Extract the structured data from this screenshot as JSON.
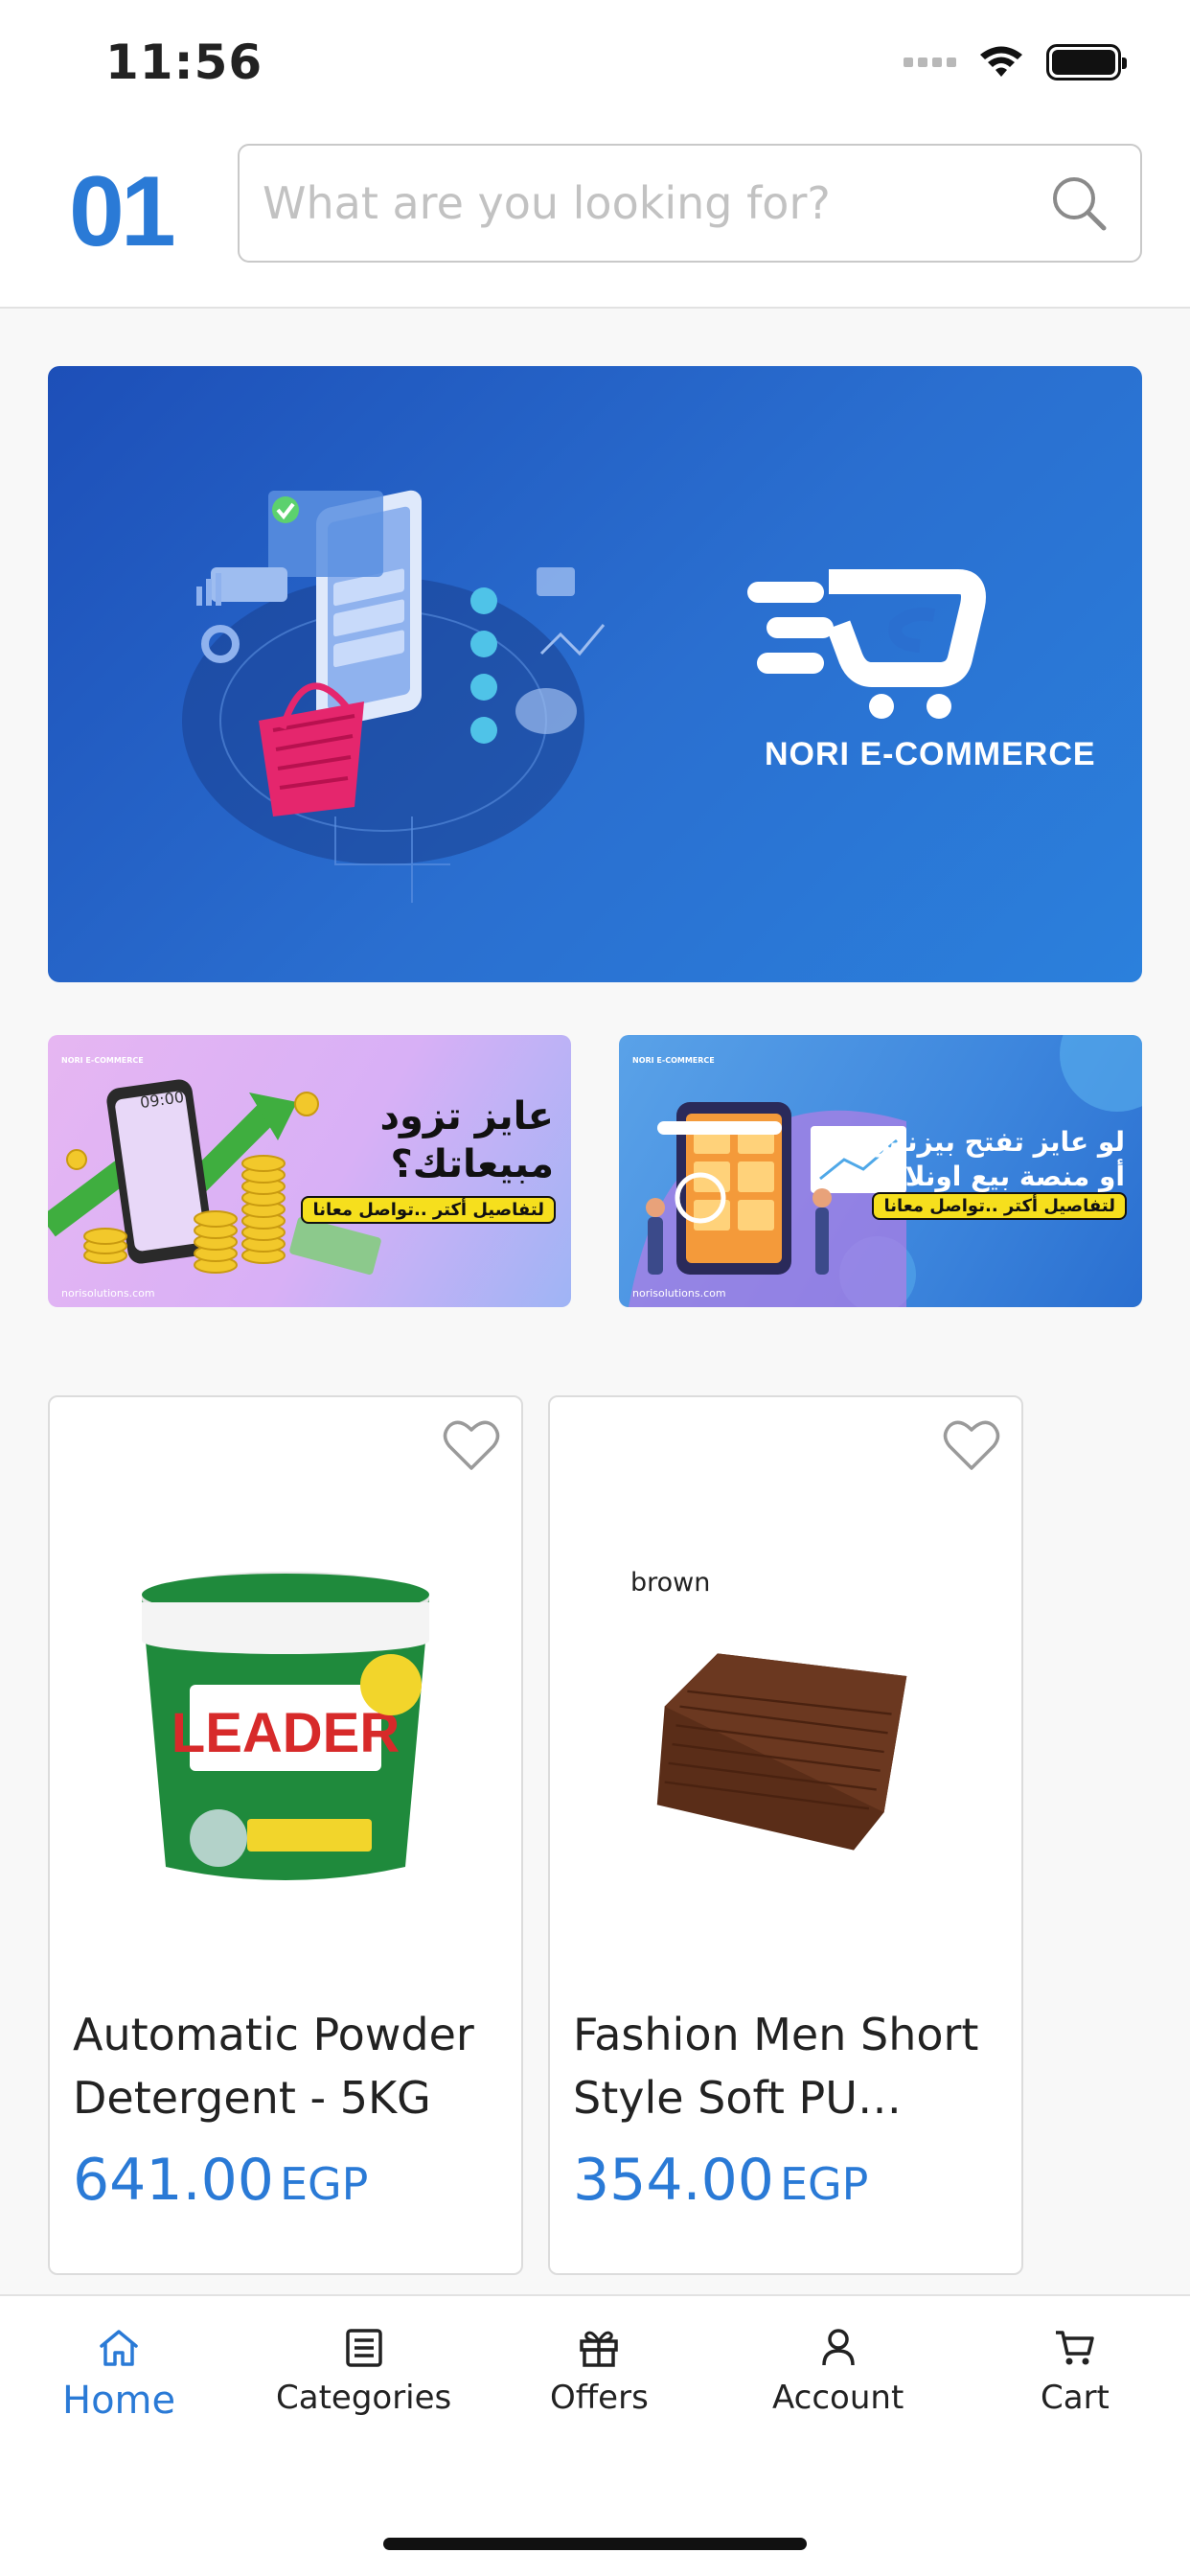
{
  "status_bar": {
    "time": "11:56"
  },
  "header": {
    "logo": "01",
    "search": {
      "placeholder": "What are you looking for?",
      "value": ""
    }
  },
  "banner": {
    "brand": "NORI E-COMMERCE"
  },
  "promos": [
    {
      "headline_line1": "عايز تزود",
      "headline_line2": "مبيعاتك؟",
      "cta": "لتفاصيل أكتر ..تواصل معانا",
      "phone_time": "09:00",
      "site": "norisolutions.com",
      "brand": "NORI E-COMMERCE"
    },
    {
      "headline_line1": "لو عايز تفتح بيزنس",
      "headline_line2": "أو منصة بيع اونلاين",
      "cta": "لتفاصيل أكتر ..تواصل معانا",
      "site": "norisolutions.com",
      "brand": "NORI E-COMMERCE"
    }
  ],
  "products": [
    {
      "name": "Automatic Powder Detergent - 5KG",
      "price": "641.00",
      "currency": "EGP",
      "image_brand": "LEADER"
    },
    {
      "name": "Fashion Men Short Style Soft PU Leat…",
      "price": "354.00",
      "currency": "EGP",
      "image_label": "brown"
    }
  ],
  "tabs": [
    {
      "label": "Home",
      "icon": "home-icon",
      "active": true
    },
    {
      "label": "Categories",
      "icon": "list-icon",
      "active": false
    },
    {
      "label": "Offers",
      "icon": "gift-icon",
      "active": false
    },
    {
      "label": "Account",
      "icon": "user-icon",
      "active": false
    },
    {
      "label": "Cart",
      "icon": "cart-icon",
      "active": false
    }
  ],
  "colors": {
    "accent": "#2a7ad6",
    "banner_blue": "#2a6fd0",
    "cta_yellow": "#f6df1d"
  }
}
